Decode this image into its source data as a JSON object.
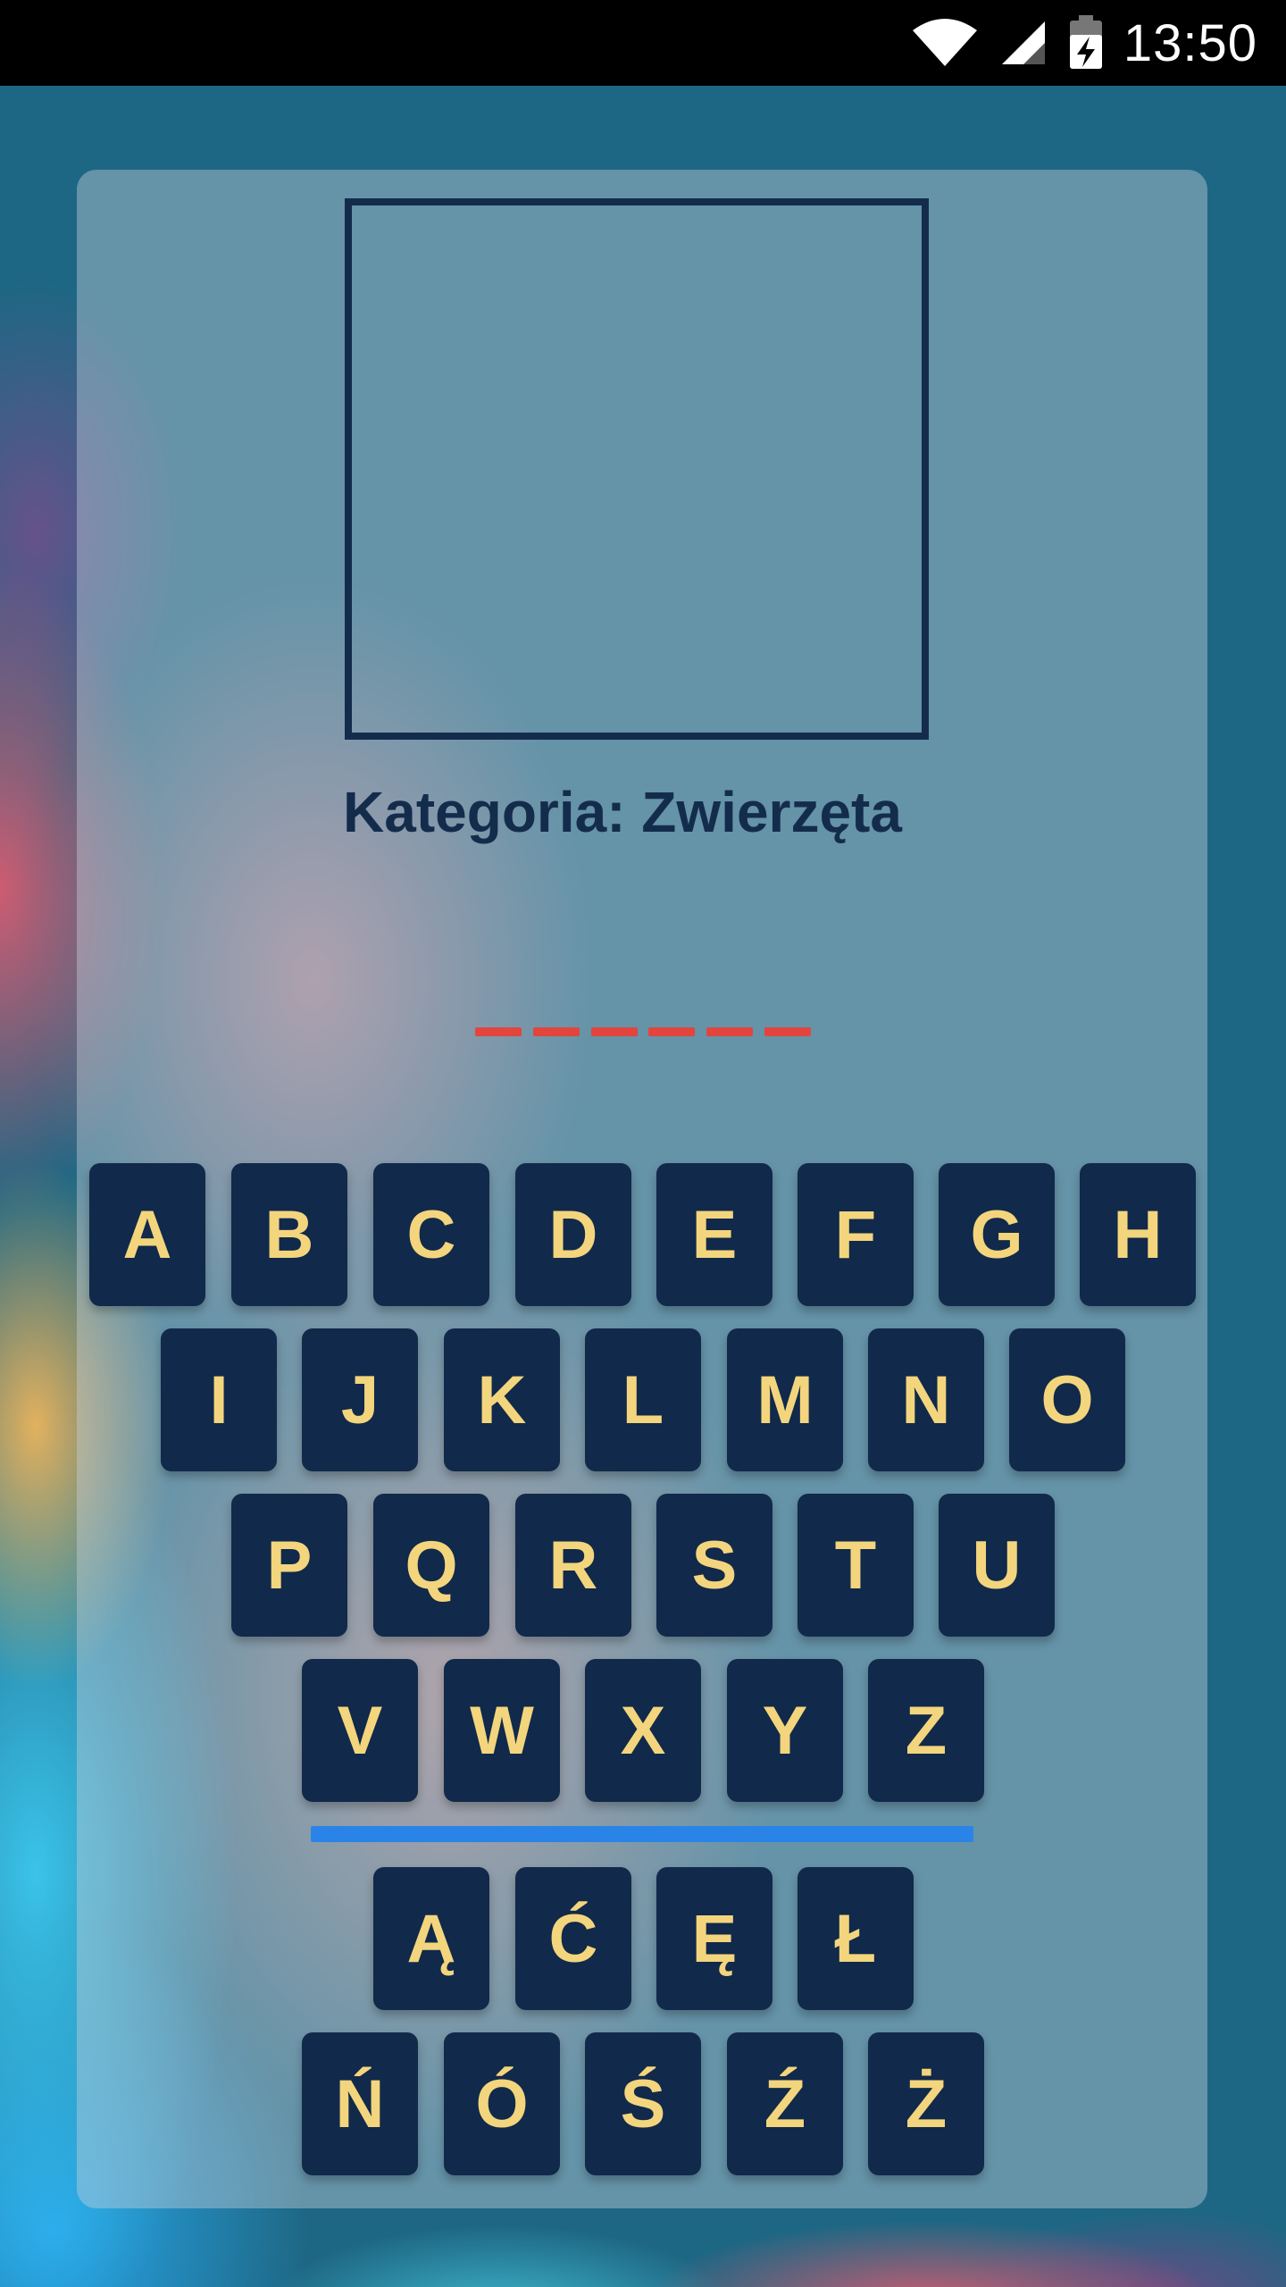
{
  "status_bar": {
    "time": "13:50",
    "icons": [
      "wifi-icon",
      "signal-icon",
      "battery-charging-icon"
    ]
  },
  "game": {
    "category_label": "Kategoria: Zwierzęta",
    "hidden_word_length": 6,
    "dash_color": "#e2453d",
    "key_background": "#11294a",
    "key_text_color": "#f3d57d",
    "separator_color": "#2a84e8"
  },
  "keyboard": {
    "row1": [
      "A",
      "B",
      "C",
      "D",
      "E",
      "F",
      "G",
      "H"
    ],
    "row2": [
      "I",
      "J",
      "K",
      "L",
      "M",
      "N",
      "O"
    ],
    "row3": [
      "P",
      "Q",
      "R",
      "S",
      "T",
      "U"
    ],
    "row4": [
      "V",
      "W",
      "X",
      "Y",
      "Z"
    ],
    "row5": [
      "Ą",
      "Ć",
      "Ę",
      "Ł"
    ],
    "row6": [
      "Ń",
      "Ó",
      "Ś",
      "Ź",
      "Ż"
    ]
  }
}
